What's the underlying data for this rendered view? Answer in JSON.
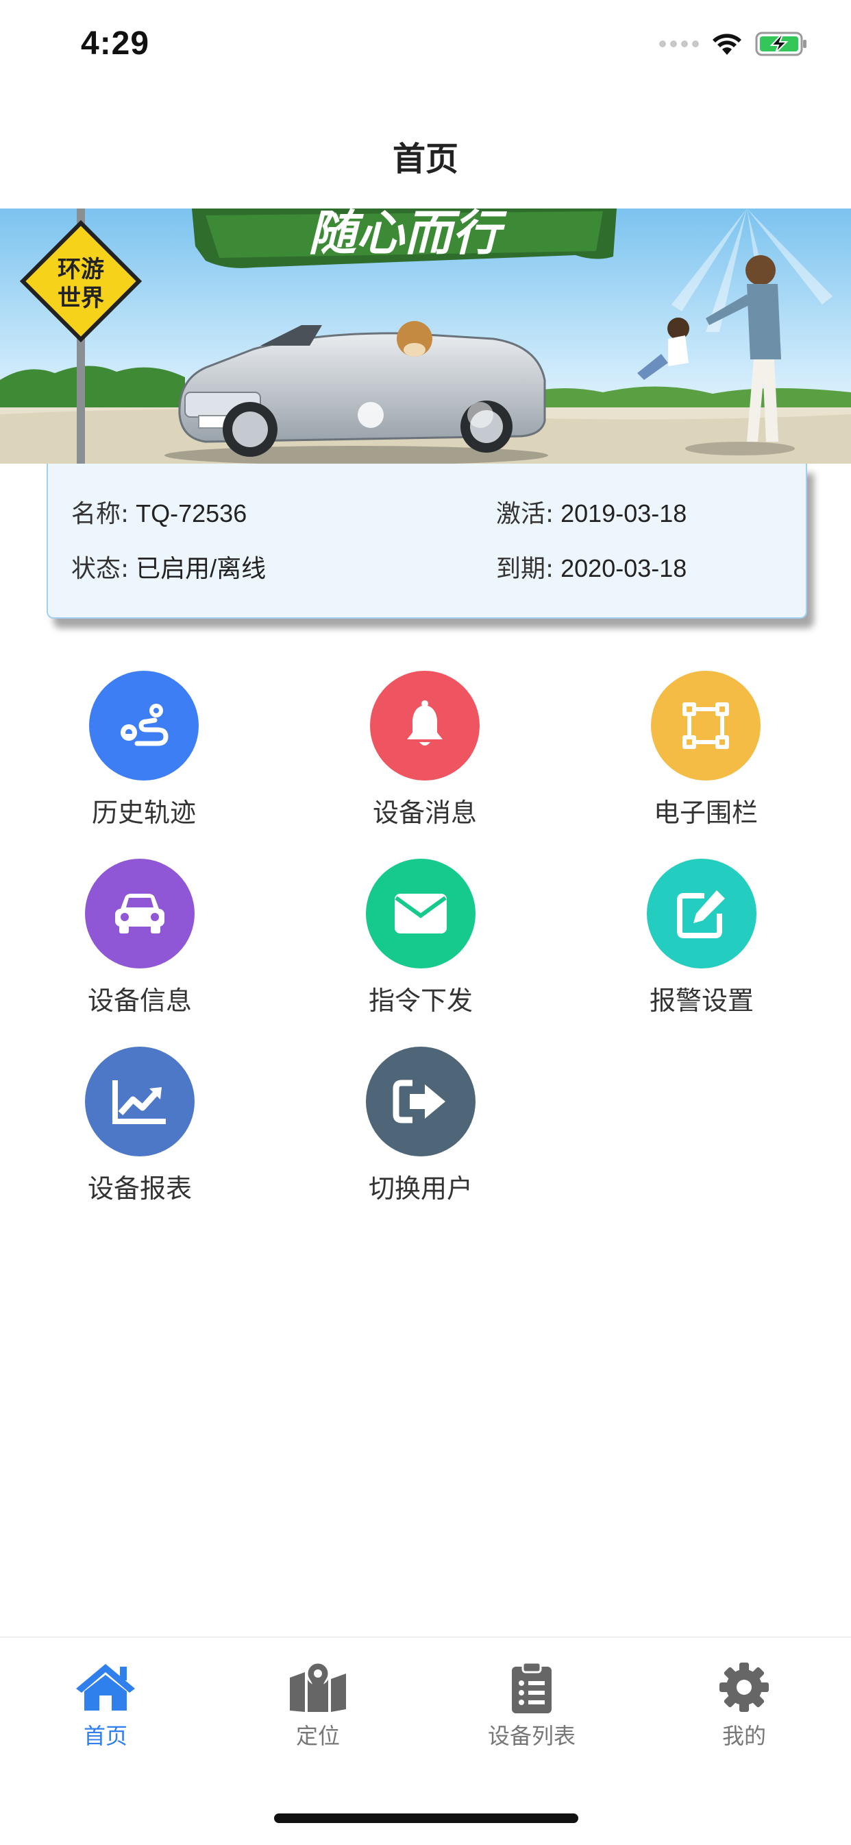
{
  "status_bar": {
    "time": "4:29",
    "icons": [
      "signal-dots-icon",
      "wifi-icon",
      "battery-charging-icon"
    ]
  },
  "nav": {
    "title": "首页"
  },
  "banner": {
    "sign_text_line1": "环游",
    "sign_text_line2": "世界",
    "slogan": "随心而行",
    "pages": 2,
    "active_page": 1
  },
  "device": {
    "name_label": "名称:",
    "name_value": "TQ-72536",
    "status_label": "状态:",
    "status_value": "已启用/离线",
    "activated_label": "激活:",
    "activated_value": "2019-03-18",
    "expiry_label": "到期:",
    "expiry_value": "2020-03-18"
  },
  "menu": [
    {
      "label": "历史轨迹",
      "icon": "route-icon",
      "color": "#3d7ef5"
    },
    {
      "label": "设备消息",
      "icon": "bell-icon",
      "color": "#ef5461"
    },
    {
      "label": "电子围栏",
      "icon": "vector-square-icon",
      "color": "#f4bb45"
    },
    {
      "label": "设备信息",
      "icon": "car-icon",
      "color": "#8f57d6"
    },
    {
      "label": "指令下发",
      "icon": "envelope-icon",
      "color": "#16c98d"
    },
    {
      "label": "报警设置",
      "icon": "edit-icon",
      "color": "#23cdbf"
    },
    {
      "label": "设备报表",
      "icon": "chart-line-icon",
      "color": "#4d78c7"
    },
    {
      "label": "切换用户",
      "icon": "sign-out-icon",
      "color": "#4e6677"
    }
  ],
  "tabs": [
    {
      "label": "首页",
      "icon": "home-icon",
      "active": true
    },
    {
      "label": "定位",
      "icon": "map-icon",
      "active": false
    },
    {
      "label": "设备列表",
      "icon": "clipboard-list-icon",
      "active": false
    },
    {
      "label": "我的",
      "icon": "gear-icon",
      "active": false
    }
  ],
  "colors": {
    "accent": "#2f80ed",
    "tab_inactive": "#777777",
    "card_bg": "#eef6fd"
  }
}
